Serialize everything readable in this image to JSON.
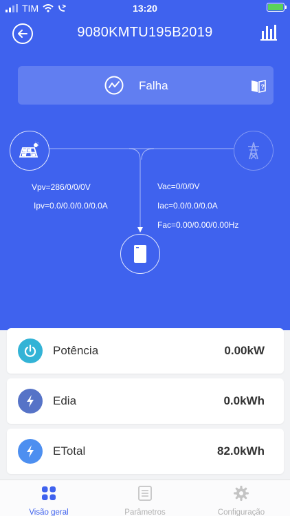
{
  "status_bar": {
    "carrier": "TIM",
    "time": "13:20"
  },
  "header": {
    "title": "9080KMTU195B2019"
  },
  "status_card": {
    "label": "Falha"
  },
  "pv": {
    "voltage": "Vpv=286/0/0/0V",
    "current": "Ipv=0.0/0.0/0.0/0.0A"
  },
  "ac": {
    "voltage": "Vac=0/0/0V",
    "current": "Iac=0.0/0.0/0.0A",
    "frequency": "Fac=0.00/0.00/0.00Hz"
  },
  "metrics": [
    {
      "label": "Potência",
      "value": "0.00kW",
      "icon": "power-icon",
      "color": "#33b3d6"
    },
    {
      "label": "Edia",
      "value": "0.0kWh",
      "icon": "lightning-icon",
      "color": "#5673c7"
    },
    {
      "label": "ETotal",
      "value": "82.0kWh",
      "icon": "lightning-icon",
      "color": "#4d8ff0"
    }
  ],
  "tabs": [
    {
      "label": "Visão geral",
      "icon": "grid-icon",
      "active": true
    },
    {
      "label": "Parâmetros",
      "icon": "list-icon",
      "active": false
    },
    {
      "label": "Configuração",
      "icon": "gear-icon",
      "active": false
    }
  ],
  "colors": {
    "primary": "#3f62ee",
    "background": "#f2f3f5",
    "inactive": "#b1b1b1"
  }
}
